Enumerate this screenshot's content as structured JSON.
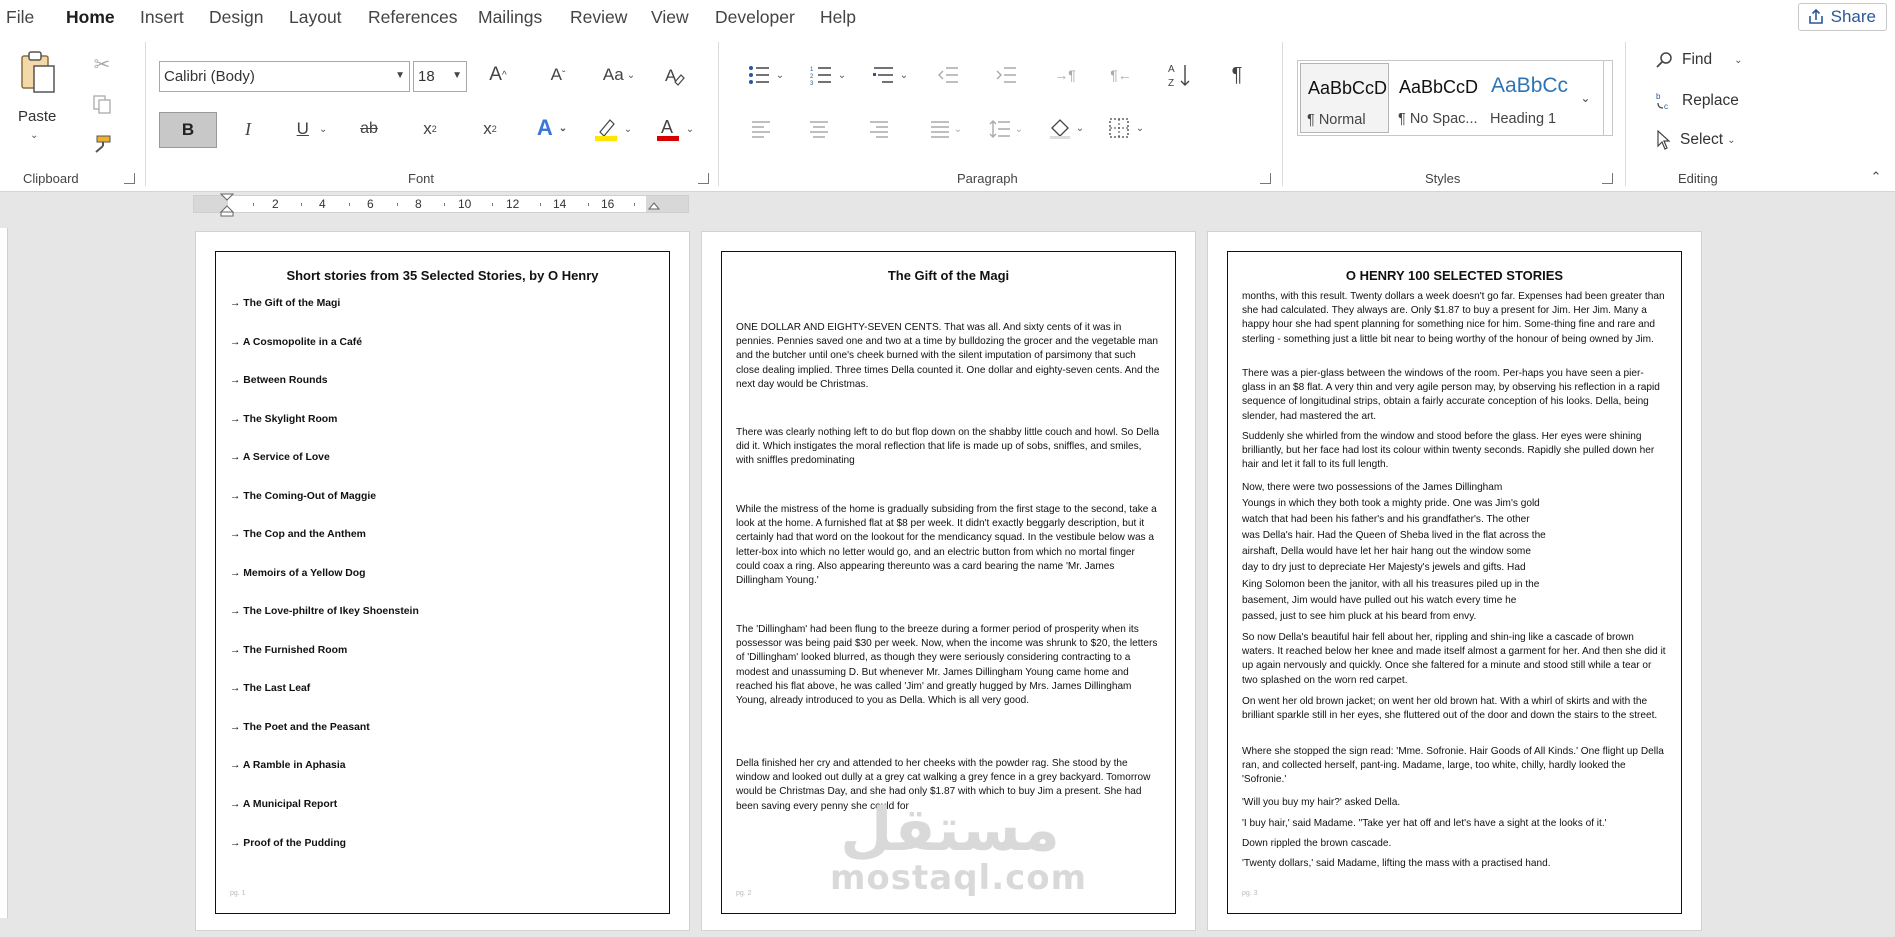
{
  "menu": {
    "tabs": [
      "File",
      "Home",
      "Insert",
      "Design",
      "Layout",
      "References",
      "Mailings",
      "Review",
      "View",
      "Developer",
      "Help"
    ],
    "active": "Home",
    "share_label": "Share"
  },
  "ribbon": {
    "clipboard": {
      "paste_label": "Paste",
      "group_label": "Clipboard"
    },
    "font": {
      "font_name": "Calibri (Body)",
      "font_size": "18",
      "group_label": "Font",
      "change_case_label": "Aa",
      "bold_label": "B",
      "italic_label": "I",
      "underline_label": "U",
      "strike_label": "ab",
      "subscript_label": "x",
      "superscript_label": "x",
      "text_effects_label": "A",
      "font_color_label": "A",
      "highlight_color": "#ffe500",
      "font_color": "#d80000"
    },
    "paragraph": {
      "group_label": "Paragraph"
    },
    "styles": {
      "group_label": "Styles",
      "items": [
        {
          "preview": "AaBbCcD",
          "name": "¶ Normal",
          "color": "#111111"
        },
        {
          "preview": "AaBbCcD",
          "name": "¶ No Spac...",
          "color": "#111111"
        },
        {
          "preview": "AaBbCc",
          "name": "Heading 1",
          "color": "#2e74b5"
        }
      ]
    },
    "editing": {
      "group_label": "Editing",
      "find_label": "Find",
      "replace_label": "Replace",
      "select_label": "Select"
    }
  },
  "ruler": {
    "labels": [
      "2",
      "4",
      "6",
      "8",
      "10",
      "12",
      "14",
      "16"
    ]
  },
  "pages": {
    "page1": {
      "title": "Short stories from 35 Selected Stories, by O Henry",
      "items": [
        "The Gift of the Magi",
        "A Cosmopolite in a Café",
        "Between Rounds",
        "The Skylight Room",
        "A Service of Love",
        "The Coming-Out of Maggie",
        "The Cop and the Anthem",
        "Memoirs of a Yellow Dog",
        "The Love-philtre of Ikey Shoenstein",
        "The Furnished Room",
        "The Last Leaf",
        "The Poet and the Peasant",
        "A Ramble in Aphasia",
        "A Municipal Report",
        "Proof of the Pudding"
      ],
      "page_number": "pg. 1"
    },
    "page2": {
      "title": "The Gift of the Magi",
      "paragraphs": [
        "ONE DOLLAR AND EIGHTY-SEVEN CENTS. That was all. And sixty cents of it was in pennies. Pennies saved one and two at a time by bulldozing the grocer and the vegetable man and the butcher until one's cheek burned with the silent imputation of parsimony that such close dealing implied. Three times Della counted it. One dollar and eighty-seven cents. And the next day would be Christmas.",
        "There was clearly nothing left to do but flop down on the shabby little couch and howl. So Della did it. Which instigates the moral reflection that life is made up of sobs, sniffles, and smiles, with sniffles predominating",
        "While the mistress of the home is gradually subsiding from the first stage to the second, take a look at the home. A furnished flat at $8 per week. It didn't exactly beggarly description, but it certainly had that word on the lookout for the mendicancy squad. In the vestibule below was a letter-box into which no letter would go, and an electric button from which no mortal finger could coax a ring. Also appearing thereunto was a card bearing the name 'Mr. James Dillingham Young.'",
        "The 'Dillingham' had been flung to the breeze during a former period of prosperity when its possessor was being paid $30 per week. Now, when the income was shrunk to $20, the letters of 'Dillingham' looked blurred, as though they were seriously considering contracting to a modest and unassuming D. But whenever Mr. James Dillingham Young came home and reached his flat above, he was called 'Jim' and greatly hugged by Mrs. James Dillingham Young, already introduced to you as Della. Which is all very good.",
        "Della finished her cry and attended to her cheeks with the powder rag. She stood by the window and looked out dully at a grey cat walking a grey fence in a grey backyard. Tomorrow would be Christmas Day, and she had only $1.87 with which to buy Jim a present. She had been saving every penny she could for"
      ],
      "page_number": "pg. 2"
    },
    "page3": {
      "title": "O HENRY 100 SELECTED STORIES",
      "p1": "months, with this result. Twenty dollars a week doesn't go far. Expenses had been greater than she had calculated. They always are. Only $1.87 to buy a present for Jim. Her Jim. Many a happy hour she had spent planning for something nice for him. Some-thing fine and rare and sterling - something just a little bit near to being worthy of the honour of being owned by Jim.",
      "p2": "There was a pier-glass between the windows of the room. Per-haps you have seen a pier-glass in an $8 flat. A very thin and very agile person may, by observing his reflection in a rapid sequence of longitudinal strips, obtain a fairly accurate conception of his looks. Della, being slender, had mastered the art.",
      "p3": "Suddenly she whirled from the window and stood before the glass. Her eyes were shining brilliantly, but her face had lost its colour within twenty seconds. Rapidly she pulled down her hair and let it fall to its full length.",
      "poem": [
        "Now, there were two possessions of the James Dillingham",
        "Youngs in which they both took a mighty pride. One was Jim's gold",
        "watch that had been his father's and his grandfather's. The other",
        "was Della's hair. Had the Queen of Sheba lived in the flat across the",
        "airshaft, Della would have let her hair hang out the window some",
        "day to dry just to depreciate Her Majesty's jewels and gifts. Had",
        "King Solomon been the janitor, with all his treasures piled up in the",
        "basement, Jim would have pulled out his watch every time he",
        "passed, just to see him pluck at his beard from envy."
      ],
      "p4": "So now Della's beautiful hair fell about her, rippling and shin-ing like a cascade of brown waters. It reached below her knee and made itself almost a garment for her. And then she did it up again nervously and quickly. Once she faltered for a minute and stood still while a tear or two splashed on the worn red carpet.",
      "p5": "On went her old brown jacket; on went her old brown hat. With a whirl of skirts and with the brilliant sparkle still in her eyes, she fluttered out of the door and down the stairs to the street.",
      "p6": "Where she stopped the sign read: 'Mme. Sofronie. Hair Goods of All Kinds.' One flight up Della ran, and collected herself, pant-ing. Madame, large, too white, chilly, hardly looked the 'Sofronie.'",
      "p7": "'Will you buy my hair?' asked Della.",
      "p8": "'I buy hair,' said Madame. \"Take yer hat off and let's have a sight at the looks of it.'",
      "p9": "Down rippled the brown cascade.",
      "p10": "'Twenty dollars,' said Madame, lifting the mass with a practised hand.",
      "page_number": "pg. 3"
    }
  },
  "watermark": {
    "arabic": "مستقل",
    "latin": "mostaql.com"
  }
}
